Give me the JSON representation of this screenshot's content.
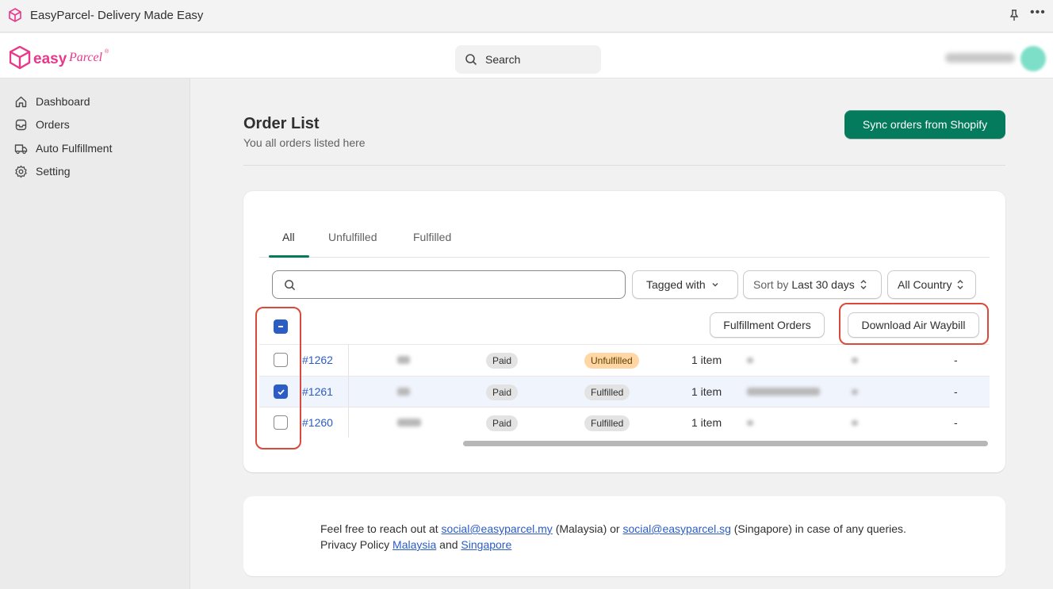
{
  "window": {
    "title": "EasyParcel- Delivery Made Easy"
  },
  "header": {
    "search_placeholder": "Search"
  },
  "sidebar": {
    "items": [
      {
        "label": "Dashboard",
        "icon": "home-icon"
      },
      {
        "label": "Orders",
        "icon": "inbox-icon"
      },
      {
        "label": "Auto Fulfillment",
        "icon": "truck-icon"
      },
      {
        "label": "Setting",
        "icon": "gear-icon"
      }
    ]
  },
  "main": {
    "title": "Order List",
    "subtitle": "You all orders listed here",
    "sync_button": "Sync orders from Shopify",
    "tabs": [
      {
        "label": "All",
        "active": true
      },
      {
        "label": "Unfulfilled",
        "active": false
      },
      {
        "label": "Fulfilled",
        "active": false
      }
    ],
    "filters": {
      "tagged_with": "Tagged with",
      "sort_prefix": "Sort by",
      "sort_value": "Last 30 days",
      "country": "All Country"
    },
    "bulk_actions": {
      "fulfillment_orders": "Fulfillment Orders",
      "download_waybill": "Download Air Waybill"
    },
    "orders": [
      {
        "id": "#1262",
        "payment": "Paid",
        "fulfillment": "Unfulfilled",
        "items": "1 item",
        "last": "-",
        "checked": false
      },
      {
        "id": "#1261",
        "payment": "Paid",
        "fulfillment": "Fulfilled",
        "items": "1 item",
        "last": "-",
        "checked": true
      },
      {
        "id": "#1260",
        "payment": "Paid",
        "fulfillment": "Fulfilled",
        "items": "1 item",
        "last": "-",
        "checked": false
      }
    ]
  },
  "footer": {
    "line1_prefix": "Feel free to reach out at",
    "email_my": "social@easyparcel.my",
    "line1_mid1": "(Malaysia) or",
    "email_sg": "social@easyparcel.sg",
    "line1_suffix": "(Singapore) in case of any queries.",
    "line2_prefix": "Privacy Policy",
    "link_malaysia": "Malaysia",
    "line2_and": "and",
    "link_singapore": "Singapore"
  },
  "colors": {
    "accent": "#047b5d",
    "link": "#2c5cc5",
    "highlight": "#d94a3a",
    "brand": "#e8388a"
  }
}
